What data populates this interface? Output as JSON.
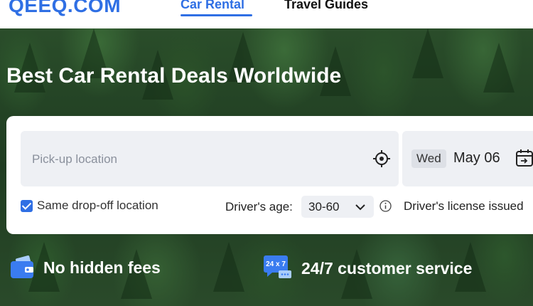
{
  "header": {
    "logo": "QEEQ.COM",
    "nav": [
      {
        "label": "Car Rental",
        "active": true
      },
      {
        "label": "Travel Guides",
        "active": false
      }
    ]
  },
  "hero": {
    "title": "Best Car Rental Deals Worldwide"
  },
  "search": {
    "pickup_placeholder": "Pick-up location",
    "date": {
      "day": "Wed",
      "value": "May 06"
    },
    "same_dropoff": {
      "label": "Same drop-off location",
      "checked": true
    },
    "driver_age": {
      "label": "Driver's age:",
      "value": "30-60"
    },
    "license_label": "Driver's license issued"
  },
  "features": [
    {
      "icon": "wallet-icon",
      "label": "No hidden fees"
    },
    {
      "icon": "support-24x7-icon",
      "badge": "24 x 7",
      "label": "24/7 customer service"
    }
  ],
  "colors": {
    "accent": "#2f6fe4",
    "field_bg": "#eef0f4"
  }
}
